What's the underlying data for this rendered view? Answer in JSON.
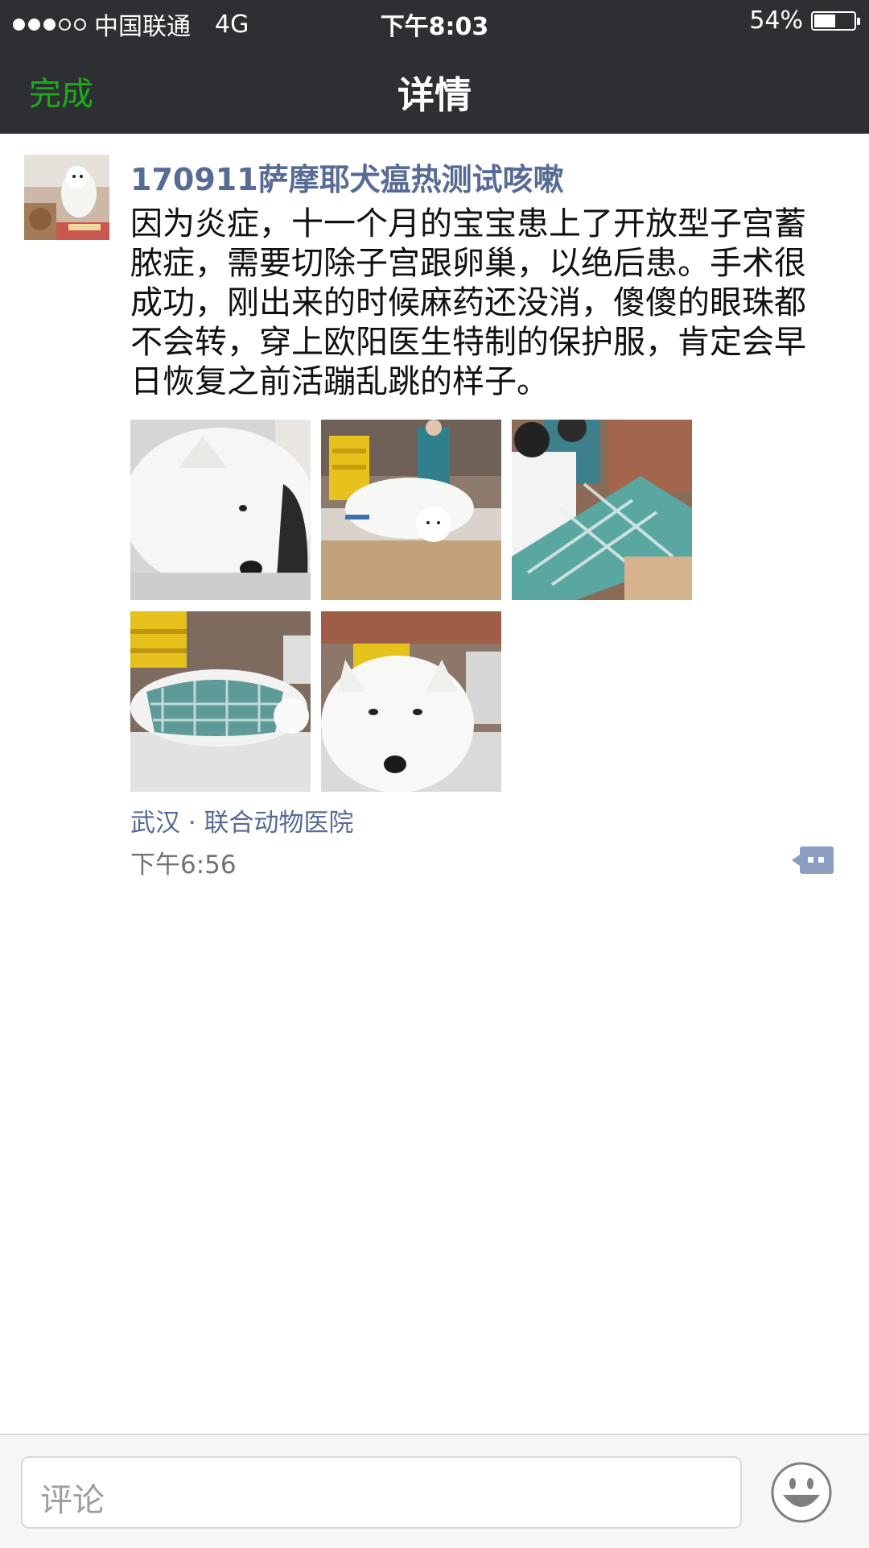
{
  "status_bar": {
    "carrier": "中国联通",
    "network": "4G",
    "time": "下午8:03",
    "battery_text": "54%",
    "battery_level": 0.54,
    "signal_strength": 3,
    "signal_max": 5
  },
  "nav": {
    "done_label": "完成",
    "title": "详情"
  },
  "post": {
    "author": "170911萨摩耶犬瘟热测试咳嗽",
    "text": "因为炎症，十一个月的宝宝患上了开放型子宫蓄脓症，需要切除子宫跟卵巢，以绝后患。手术很成功，刚出来的时候麻药还没消，傻傻的眼珠都不会转，穿上欧阳医生特制的保护服，肯定会早日恢复之前活蹦乱跳的样子。",
    "photo_count": 5,
    "location": "武汉 · 联合动物医院",
    "time": "下午6:56"
  },
  "comment_bar": {
    "placeholder": "评论",
    "emoji_icon": "smiley-face-icon"
  },
  "colors": {
    "bar_background": "#2e2f33",
    "accent_green": "#1aad19",
    "link_blue": "#576b95",
    "meta_gray": "#737373"
  }
}
